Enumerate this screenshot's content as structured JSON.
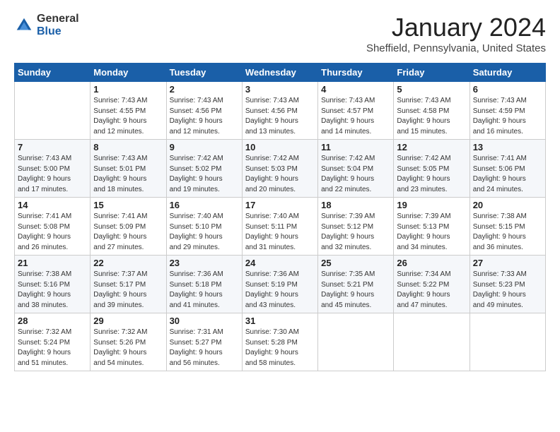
{
  "logo": {
    "general": "General",
    "blue": "Blue"
  },
  "title": "January 2024",
  "subtitle": "Sheffield, Pennsylvania, United States",
  "days_header": [
    "Sunday",
    "Monday",
    "Tuesday",
    "Wednesday",
    "Thursday",
    "Friday",
    "Saturday"
  ],
  "weeks": [
    [
      {
        "num": "",
        "info": ""
      },
      {
        "num": "1",
        "info": "Sunrise: 7:43 AM\nSunset: 4:55 PM\nDaylight: 9 hours\nand 12 minutes."
      },
      {
        "num": "2",
        "info": "Sunrise: 7:43 AM\nSunset: 4:56 PM\nDaylight: 9 hours\nand 12 minutes."
      },
      {
        "num": "3",
        "info": "Sunrise: 7:43 AM\nSunset: 4:56 PM\nDaylight: 9 hours\nand 13 minutes."
      },
      {
        "num": "4",
        "info": "Sunrise: 7:43 AM\nSunset: 4:57 PM\nDaylight: 9 hours\nand 14 minutes."
      },
      {
        "num": "5",
        "info": "Sunrise: 7:43 AM\nSunset: 4:58 PM\nDaylight: 9 hours\nand 15 minutes."
      },
      {
        "num": "6",
        "info": "Sunrise: 7:43 AM\nSunset: 4:59 PM\nDaylight: 9 hours\nand 16 minutes."
      }
    ],
    [
      {
        "num": "7",
        "info": "Sunrise: 7:43 AM\nSunset: 5:00 PM\nDaylight: 9 hours\nand 17 minutes."
      },
      {
        "num": "8",
        "info": "Sunrise: 7:43 AM\nSunset: 5:01 PM\nDaylight: 9 hours\nand 18 minutes."
      },
      {
        "num": "9",
        "info": "Sunrise: 7:42 AM\nSunset: 5:02 PM\nDaylight: 9 hours\nand 19 minutes."
      },
      {
        "num": "10",
        "info": "Sunrise: 7:42 AM\nSunset: 5:03 PM\nDaylight: 9 hours\nand 20 minutes."
      },
      {
        "num": "11",
        "info": "Sunrise: 7:42 AM\nSunset: 5:04 PM\nDaylight: 9 hours\nand 22 minutes."
      },
      {
        "num": "12",
        "info": "Sunrise: 7:42 AM\nSunset: 5:05 PM\nDaylight: 9 hours\nand 23 minutes."
      },
      {
        "num": "13",
        "info": "Sunrise: 7:41 AM\nSunset: 5:06 PM\nDaylight: 9 hours\nand 24 minutes."
      }
    ],
    [
      {
        "num": "14",
        "info": "Sunrise: 7:41 AM\nSunset: 5:08 PM\nDaylight: 9 hours\nand 26 minutes."
      },
      {
        "num": "15",
        "info": "Sunrise: 7:41 AM\nSunset: 5:09 PM\nDaylight: 9 hours\nand 27 minutes."
      },
      {
        "num": "16",
        "info": "Sunrise: 7:40 AM\nSunset: 5:10 PM\nDaylight: 9 hours\nand 29 minutes."
      },
      {
        "num": "17",
        "info": "Sunrise: 7:40 AM\nSunset: 5:11 PM\nDaylight: 9 hours\nand 31 minutes."
      },
      {
        "num": "18",
        "info": "Sunrise: 7:39 AM\nSunset: 5:12 PM\nDaylight: 9 hours\nand 32 minutes."
      },
      {
        "num": "19",
        "info": "Sunrise: 7:39 AM\nSunset: 5:13 PM\nDaylight: 9 hours\nand 34 minutes."
      },
      {
        "num": "20",
        "info": "Sunrise: 7:38 AM\nSunset: 5:15 PM\nDaylight: 9 hours\nand 36 minutes."
      }
    ],
    [
      {
        "num": "21",
        "info": "Sunrise: 7:38 AM\nSunset: 5:16 PM\nDaylight: 9 hours\nand 38 minutes."
      },
      {
        "num": "22",
        "info": "Sunrise: 7:37 AM\nSunset: 5:17 PM\nDaylight: 9 hours\nand 39 minutes."
      },
      {
        "num": "23",
        "info": "Sunrise: 7:36 AM\nSunset: 5:18 PM\nDaylight: 9 hours\nand 41 minutes."
      },
      {
        "num": "24",
        "info": "Sunrise: 7:36 AM\nSunset: 5:19 PM\nDaylight: 9 hours\nand 43 minutes."
      },
      {
        "num": "25",
        "info": "Sunrise: 7:35 AM\nSunset: 5:21 PM\nDaylight: 9 hours\nand 45 minutes."
      },
      {
        "num": "26",
        "info": "Sunrise: 7:34 AM\nSunset: 5:22 PM\nDaylight: 9 hours\nand 47 minutes."
      },
      {
        "num": "27",
        "info": "Sunrise: 7:33 AM\nSunset: 5:23 PM\nDaylight: 9 hours\nand 49 minutes."
      }
    ],
    [
      {
        "num": "28",
        "info": "Sunrise: 7:32 AM\nSunset: 5:24 PM\nDaylight: 9 hours\nand 51 minutes."
      },
      {
        "num": "29",
        "info": "Sunrise: 7:32 AM\nSunset: 5:26 PM\nDaylight: 9 hours\nand 54 minutes."
      },
      {
        "num": "30",
        "info": "Sunrise: 7:31 AM\nSunset: 5:27 PM\nDaylight: 9 hours\nand 56 minutes."
      },
      {
        "num": "31",
        "info": "Sunrise: 7:30 AM\nSunset: 5:28 PM\nDaylight: 9 hours\nand 58 minutes."
      },
      {
        "num": "",
        "info": ""
      },
      {
        "num": "",
        "info": ""
      },
      {
        "num": "",
        "info": ""
      }
    ]
  ]
}
